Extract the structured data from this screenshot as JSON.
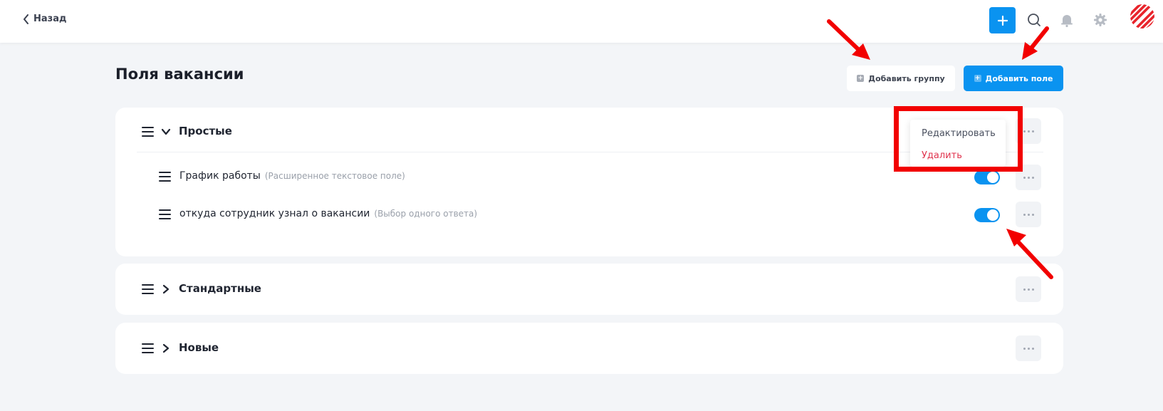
{
  "header": {
    "back_label": "Назад",
    "icons": [
      "add-icon",
      "search-icon",
      "bell-icon",
      "gear-icon",
      "logo-icon"
    ]
  },
  "page": {
    "title": "Поля вакансии",
    "add_group_label": "Добавить группу",
    "add_field_label": "Добавить поле"
  },
  "groups": [
    {
      "title": "Простые",
      "expanded": true,
      "fields": [
        {
          "name": "График работы",
          "type": "(Расширенное текстовое поле)",
          "enabled": true
        },
        {
          "name": "откуда сотрудник узнал о вакансии",
          "type": "(Выбор одного ответа)",
          "enabled": true
        }
      ]
    },
    {
      "title": "Стандартные",
      "expanded": false,
      "fields": []
    },
    {
      "title": "Новые",
      "expanded": false,
      "fields": []
    }
  ],
  "context_menu": {
    "edit_label": "Редактировать",
    "delete_label": "Удалить"
  },
  "colors": {
    "accent": "#0a93f0",
    "danger": "#e0334d",
    "annotation": "#f20000",
    "background": "#f3f5f8"
  }
}
